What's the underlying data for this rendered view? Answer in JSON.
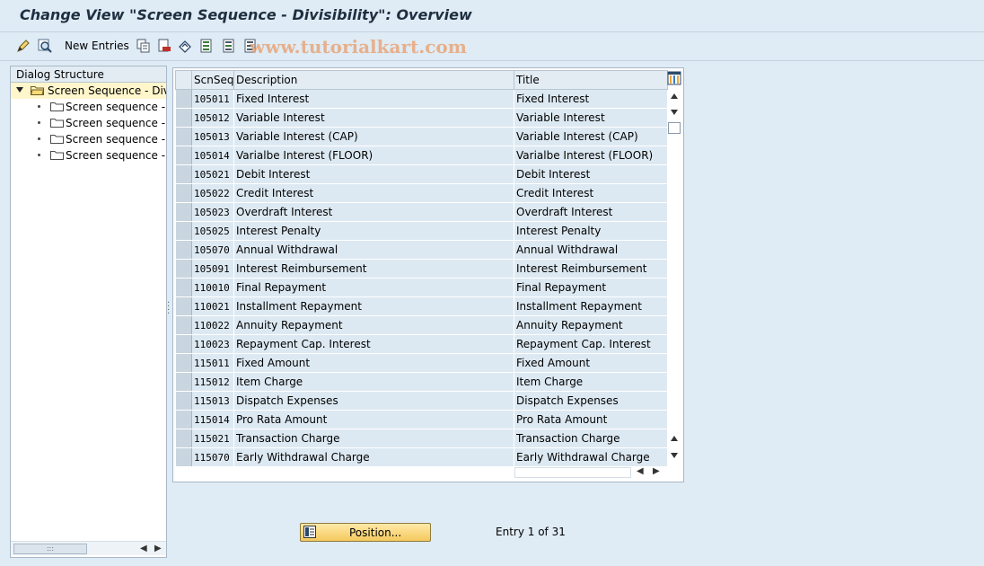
{
  "window": {
    "title": "Change View \"Screen Sequence - Divisibility\": Overview"
  },
  "toolbar": {
    "new_entries_label": "New Entries",
    "watermark": "www.tutorialkart.com",
    "icons": [
      "change-display-icon",
      "find-icon",
      "copy-icon",
      "delete-icon",
      "undo-icon",
      "select-all-icon",
      "select-block-icon",
      "deselect-all-icon"
    ]
  },
  "dialog_structure": {
    "header": "Dialog Structure",
    "root": "Screen Sequence - Divis",
    "children": [
      "Screen sequence ->",
      "Screen sequence ->",
      "Screen sequence ->",
      "Screen sequence ->"
    ]
  },
  "table": {
    "columns": {
      "seq": "ScnSeq",
      "description": "Description",
      "title": "Title"
    },
    "rows": [
      {
        "seq": "105011",
        "description": "Fixed Interest",
        "title": "Fixed Interest"
      },
      {
        "seq": "105012",
        "description": "Variable Interest",
        "title": "Variable Interest"
      },
      {
        "seq": "105013",
        "description": "Variable Interest (CAP)",
        "title": "Variable Interest (CAP)"
      },
      {
        "seq": "105014",
        "description": "Varialbe Interest (FLOOR)",
        "title": "Varialbe Interest (FLOOR)"
      },
      {
        "seq": "105021",
        "description": "Debit Interest",
        "title": "Debit Interest"
      },
      {
        "seq": "105022",
        "description": "Credit Interest",
        "title": "Credit Interest"
      },
      {
        "seq": "105023",
        "description": "Overdraft Interest",
        "title": "Overdraft Interest"
      },
      {
        "seq": "105025",
        "description": "Interest Penalty",
        "title": "Interest Penalty"
      },
      {
        "seq": "105070",
        "description": "Annual Withdrawal",
        "title": "Annual Withdrawal"
      },
      {
        "seq": "105091",
        "description": "Interest Reimbursement",
        "title": "Interest Reimbursement"
      },
      {
        "seq": "110010",
        "description": "Final Repayment",
        "title": "Final Repayment"
      },
      {
        "seq": "110021",
        "description": "Installment Repayment",
        "title": "Installment Repayment"
      },
      {
        "seq": "110022",
        "description": "Annuity Repayment",
        "title": "Annuity Repayment"
      },
      {
        "seq": "110023",
        "description": "Repayment Cap. Interest",
        "title": "Repayment Cap. Interest"
      },
      {
        "seq": "115011",
        "description": "Fixed Amount",
        "title": "Fixed Amount"
      },
      {
        "seq": "115012",
        "description": "Item Charge",
        "title": "Item Charge"
      },
      {
        "seq": "115013",
        "description": "Dispatch Expenses",
        "title": "Dispatch Expenses"
      },
      {
        "seq": "115014",
        "description": "Pro Rata Amount",
        "title": "Pro Rata Amount"
      },
      {
        "seq": "115021",
        "description": "Transaction Charge",
        "title": "Transaction Charge"
      },
      {
        "seq": "115070",
        "description": "Early Withdrawal Charge",
        "title": "Early Withdrawal Charge"
      }
    ]
  },
  "footer": {
    "position_button": "Position...",
    "entry_text": "Entry 1 of 31"
  },
  "colors": {
    "background": "#dfebf5",
    "row_background": "#dde9f2",
    "button_gold": "#f5c95e",
    "title_text": "#1e2f40"
  }
}
